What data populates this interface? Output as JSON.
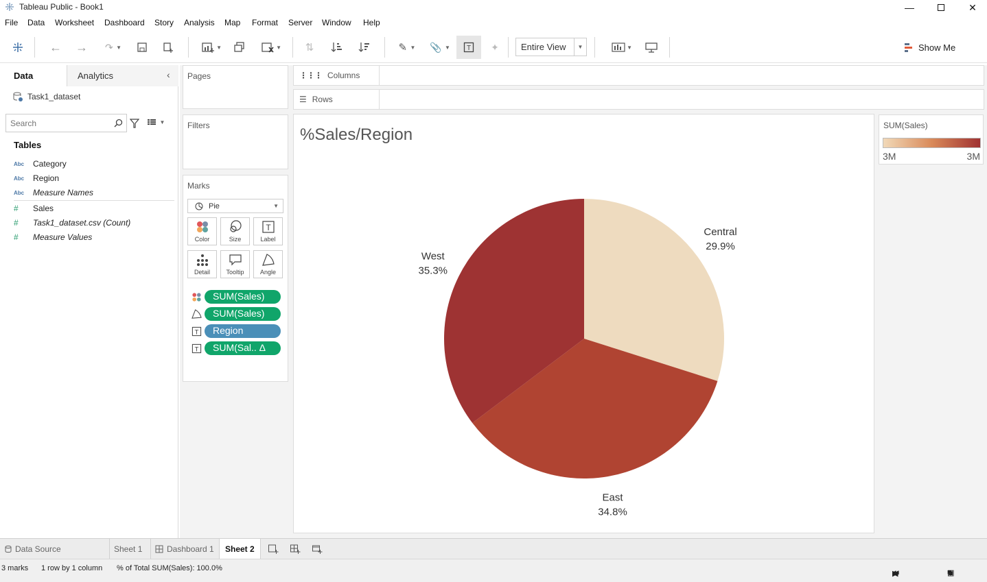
{
  "window": {
    "title": "Tableau Public - Book1"
  },
  "menu": [
    "File",
    "Data",
    "Worksheet",
    "Dashboard",
    "Story",
    "Analysis",
    "Map",
    "Format",
    "Server",
    "Window",
    "Help"
  ],
  "toolbar": {
    "fit_mode": "Entire View",
    "show_me": "Show Me"
  },
  "left_panel": {
    "tab_data": "Data",
    "tab_analytics": "Analytics",
    "datasource": "Task1_dataset",
    "search_placeholder": "Search",
    "tables_heading": "Tables",
    "dimensions": [
      {
        "type": "Abc",
        "name": "Category"
      },
      {
        "type": "Abc",
        "name": "Region"
      },
      {
        "type": "Abc",
        "name": "Measure Names"
      }
    ],
    "measures": [
      {
        "type": "#",
        "name": "Sales"
      },
      {
        "type": "#",
        "name": "Task1_dataset.csv (Count)"
      },
      {
        "type": "#",
        "name": "Measure Values"
      }
    ]
  },
  "shelves": {
    "pages": "Pages",
    "filters": "Filters",
    "columns": "Columns",
    "rows": "Rows"
  },
  "marks": {
    "heading": "Marks",
    "mark_type": "Pie",
    "buttons": [
      "Color",
      "Size",
      "Label",
      "Detail",
      "Tooltip",
      "Angle"
    ],
    "pills": [
      {
        "icon": "color",
        "label": "SUM(Sales)",
        "style": "green"
      },
      {
        "icon": "angle",
        "label": "SUM(Sales)",
        "style": "green"
      },
      {
        "icon": "label",
        "label": "Region",
        "style": "blue"
      },
      {
        "icon": "label",
        "label": "SUM(Sal.. Δ",
        "style": "green"
      }
    ]
  },
  "legend": {
    "title": "SUM(Sales)",
    "min": "3M",
    "max": "3M",
    "color_low": "#f1d9b8",
    "color_high": "#a03232"
  },
  "chart_data": {
    "type": "pie",
    "title": "%Sales/Region",
    "slices": [
      {
        "label": "Central",
        "value_label": "29.9%",
        "value": 29.9,
        "color": "#eedbbf"
      },
      {
        "label": "East",
        "value_label": "34.8%",
        "value": 34.8,
        "color": "#b04432"
      },
      {
        "label": "West",
        "value_label": "35.3%",
        "value": 35.3,
        "color": "#9e3333"
      }
    ]
  },
  "bottom_tabs": {
    "data_source": "Data Source",
    "sheet1": "Sheet 1",
    "dashboard1": "Dashboard 1",
    "sheet2": "Sheet 2"
  },
  "status": {
    "marks": "3 marks",
    "dims": "1 row by 1 column",
    "total": "% of Total SUM(Sales): 100.0%"
  }
}
